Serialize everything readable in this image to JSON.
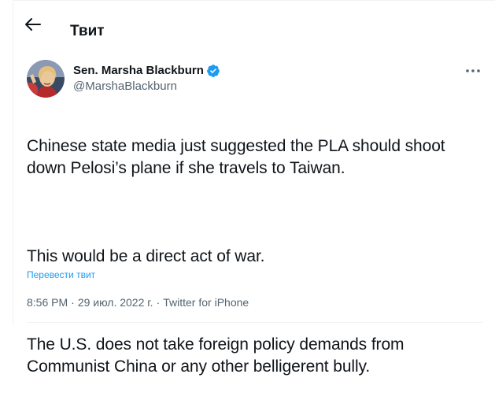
{
  "header": {
    "back_icon": "arrow-left-icon",
    "title": "Твит"
  },
  "author": {
    "name": "Sen. Marsha Blackburn",
    "handle": "@MarshaBlackburn",
    "verified": true,
    "verified_icon": "verified-badge-icon",
    "more_icon": "more-horizontal-icon"
  },
  "tweet": {
    "paragraphs": [
      "Chinese state media just suggested the PLA should shoot down Pelosi’s plane if she travels to Taiwan.",
      "This would be a direct act of war.",
      "The U.S. does not take foreign policy demands from Communist China or any other belligerent bully."
    ],
    "translate_label": "Перевести твит"
  },
  "meta": {
    "time": "8:56 PM",
    "separator": "·",
    "date": "29 июл. 2022 г.",
    "source": "Twitter for iPhone"
  },
  "colors": {
    "text": "#0f1419",
    "secondary": "#536471",
    "accent": "#1d9bf0",
    "border": "#eff3f4"
  }
}
